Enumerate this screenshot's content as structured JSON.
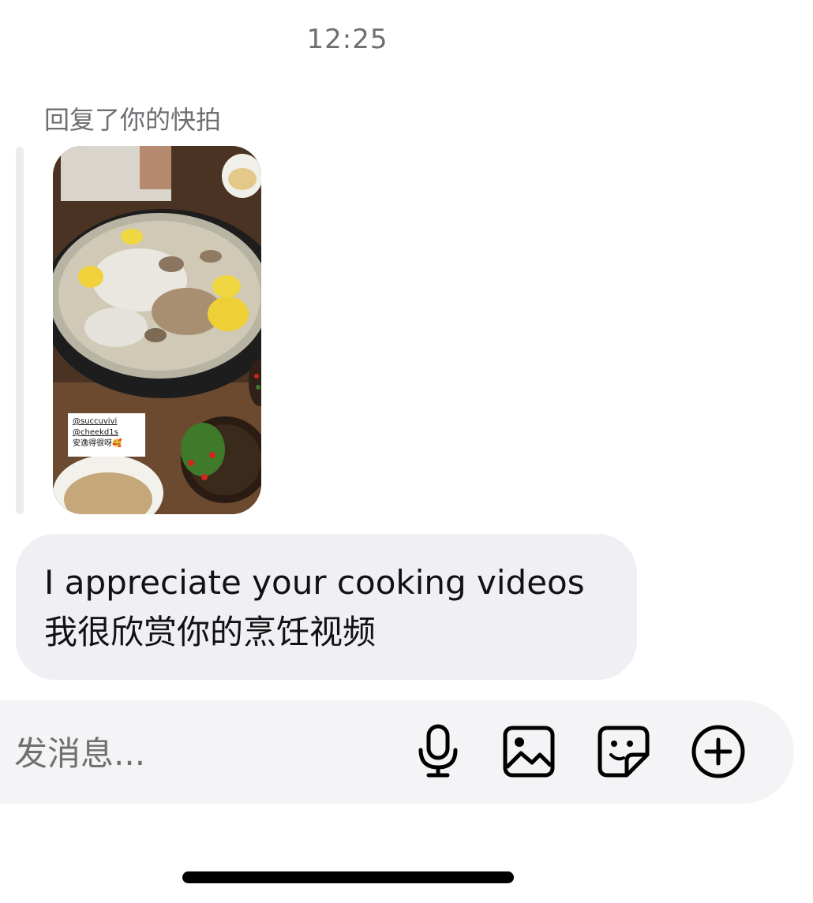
{
  "status": {
    "timestamp": "12:25"
  },
  "conversation": {
    "reply_context_label": "回复了你的快拍",
    "snap": {
      "sticker_lines": [
        "@succuvivi",
        "@cheekd1s",
        "安逸得很呀🥰"
      ]
    },
    "message": {
      "line_en": "I appreciate your cooking videos",
      "line_zh": "我很欣赏你的烹饪视频"
    }
  },
  "composer": {
    "placeholder": "发消息...",
    "icons": [
      "microphone-icon",
      "image-icon",
      "sticker-icon",
      "plus-circle-icon"
    ]
  },
  "colors": {
    "bubble": "#efeff4",
    "composer": "#f4f4f6",
    "muted_text": "#6e6e73"
  }
}
